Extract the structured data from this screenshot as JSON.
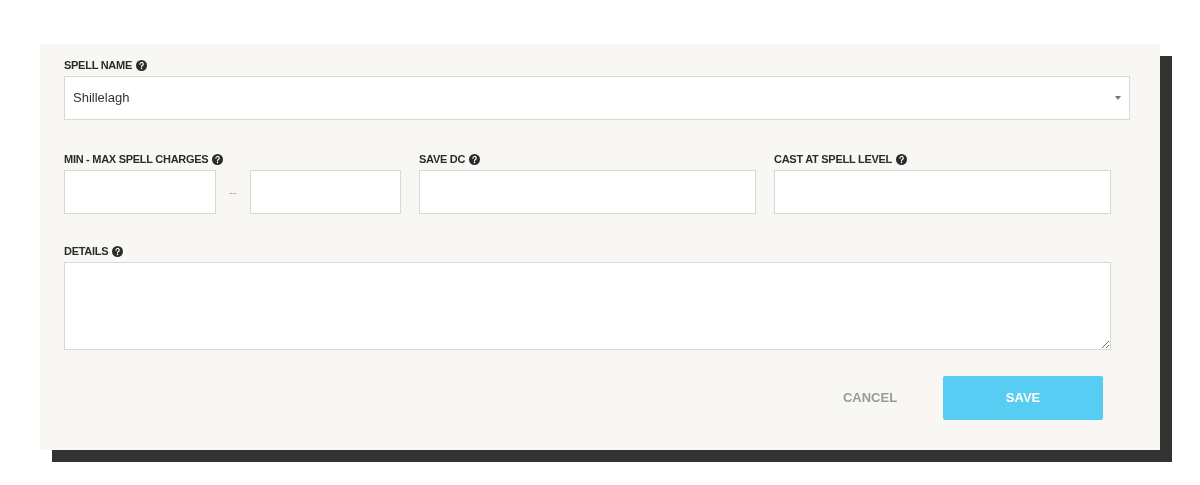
{
  "spell_name": {
    "label": "SPELL NAME",
    "value": "Shillelagh"
  },
  "charges": {
    "label": "MIN - MAX SPELL CHARGES",
    "separator": "--"
  },
  "save_dc": {
    "label": "SAVE DC"
  },
  "cast_level": {
    "label": "CAST AT SPELL LEVEL"
  },
  "details": {
    "label": "DETAILS"
  },
  "buttons": [
    {
      "kind": "text",
      "label": "CANCEL"
    },
    {
      "kind": "primary",
      "label": "SAVE"
    }
  ]
}
